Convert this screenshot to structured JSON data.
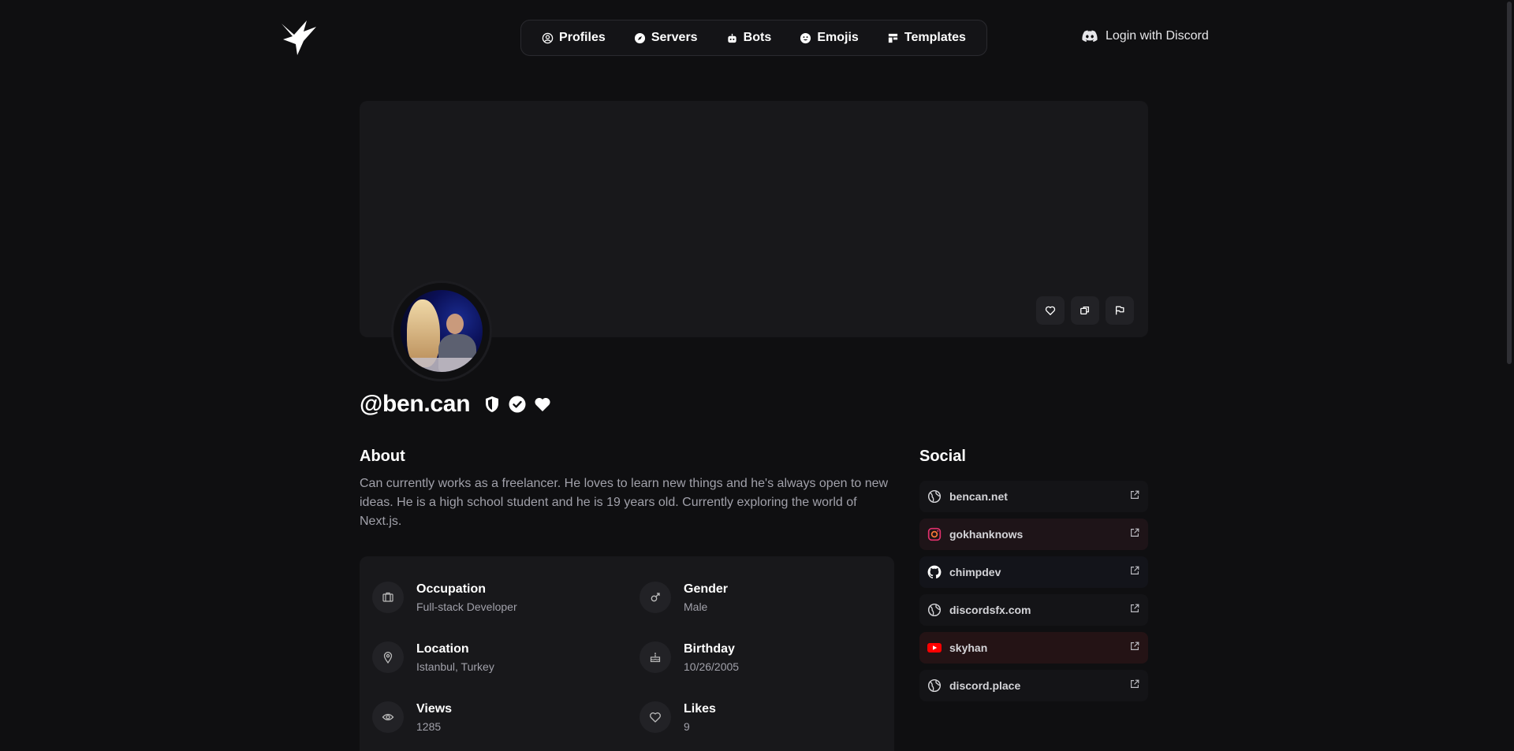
{
  "header": {
    "nav": [
      {
        "label": "Profiles",
        "icon": "user-circle-icon"
      },
      {
        "label": "Servers",
        "icon": "compass-icon"
      },
      {
        "label": "Bots",
        "icon": "robot-icon"
      },
      {
        "label": "Emojis",
        "icon": "smile-icon"
      },
      {
        "label": "Templates",
        "icon": "layout-icon"
      }
    ],
    "login_label": "Login with Discord"
  },
  "profile": {
    "username": "@ben.can",
    "badges": [
      "shield-icon",
      "verified-check-icon",
      "heart-icon"
    ]
  },
  "about": {
    "title": "About",
    "text": "Can currently works as a freelancer. He loves to learn new things and he's always open to new ideas. He is a high school student and he is 19 years old. Currently exploring the world of Next.js."
  },
  "info": {
    "occupation": {
      "label": "Occupation",
      "value": "Full-stack Developer"
    },
    "gender": {
      "label": "Gender",
      "value": "Male"
    },
    "location": {
      "label": "Location",
      "value": "Istanbul, Turkey"
    },
    "birthday": {
      "label": "Birthday",
      "value": "10/26/2005"
    },
    "views": {
      "label": "Views",
      "value": "1285"
    },
    "likes": {
      "label": "Likes",
      "value": "9"
    }
  },
  "social": {
    "title": "Social",
    "items": [
      {
        "name": "bencan.net",
        "type": "globe"
      },
      {
        "name": "gokhanknows",
        "type": "instagram"
      },
      {
        "name": "chimpdev",
        "type": "github"
      },
      {
        "name": "discordsfx.com",
        "type": "globe"
      },
      {
        "name": "skyhan",
        "type": "youtube"
      },
      {
        "name": "discord.place",
        "type": "globe"
      }
    ]
  },
  "colors": {
    "background": "#0f0f11",
    "card": "#18181b",
    "muted_text": "#a1a1aa",
    "instagram": "#e1306c",
    "youtube": "#ff0000"
  }
}
